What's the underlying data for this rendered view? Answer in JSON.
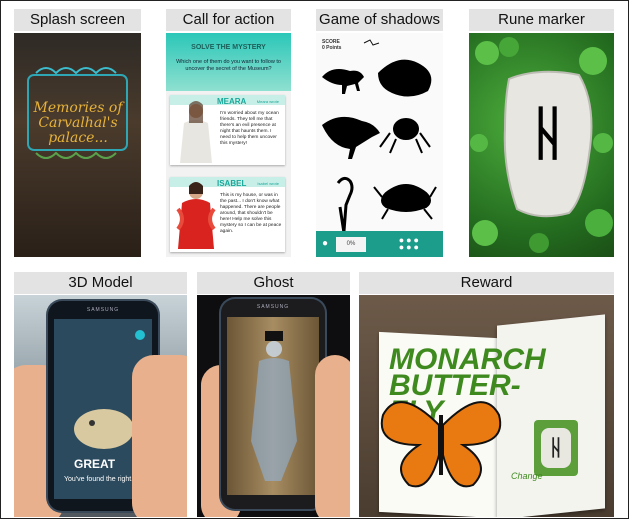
{
  "labels": {
    "splash": "Splash screen",
    "cfa": "Call for action",
    "shadows": "Game of shadows",
    "rune": "Rune marker",
    "model": "3D Model",
    "ghost": "Ghost",
    "reward": "Reward"
  },
  "splash": {
    "title": "Memories of Carvalhal's palace..."
  },
  "cfa": {
    "heading": "SOLVE THE MYSTERY",
    "question": "Which one of them do you want to follow to uncover the secret of the Museum?",
    "cards": [
      {
        "name": "MEARA",
        "link": "Meara wrote",
        "text": "I'm worried about my ocean friends. They tell me that there's an evil presence at night that haunts them. I need to help them uncover this mystery!"
      },
      {
        "name": "ISABEL",
        "link": "Isabel wrote",
        "text": "This is my house, or was in the past... I don't know what happened. There are people around, that shouldn't be here! Help me solve this mystery so I can be at peace again."
      }
    ]
  },
  "shadows": {
    "score_label": "SCORE",
    "points": "0 Points",
    "progress": "0%"
  },
  "rune": {
    "letter": "ᚺ"
  },
  "model": {
    "phone_brand": "SAMSUNG",
    "message_title": "GREAT",
    "message_body": "You've found the right..."
  },
  "ghost": {
    "phone_brand": "SAMSUNG"
  },
  "reward": {
    "title_line1": "MONARCH",
    "title_line2": "BUTTER-",
    "title_line3": "FLY",
    "change_label": "Change",
    "rune_letter": "ᚺ"
  },
  "colors": {
    "teal": "#1c9c8a",
    "green_title": "#3e8a1f",
    "gold": "#e6b23a"
  }
}
